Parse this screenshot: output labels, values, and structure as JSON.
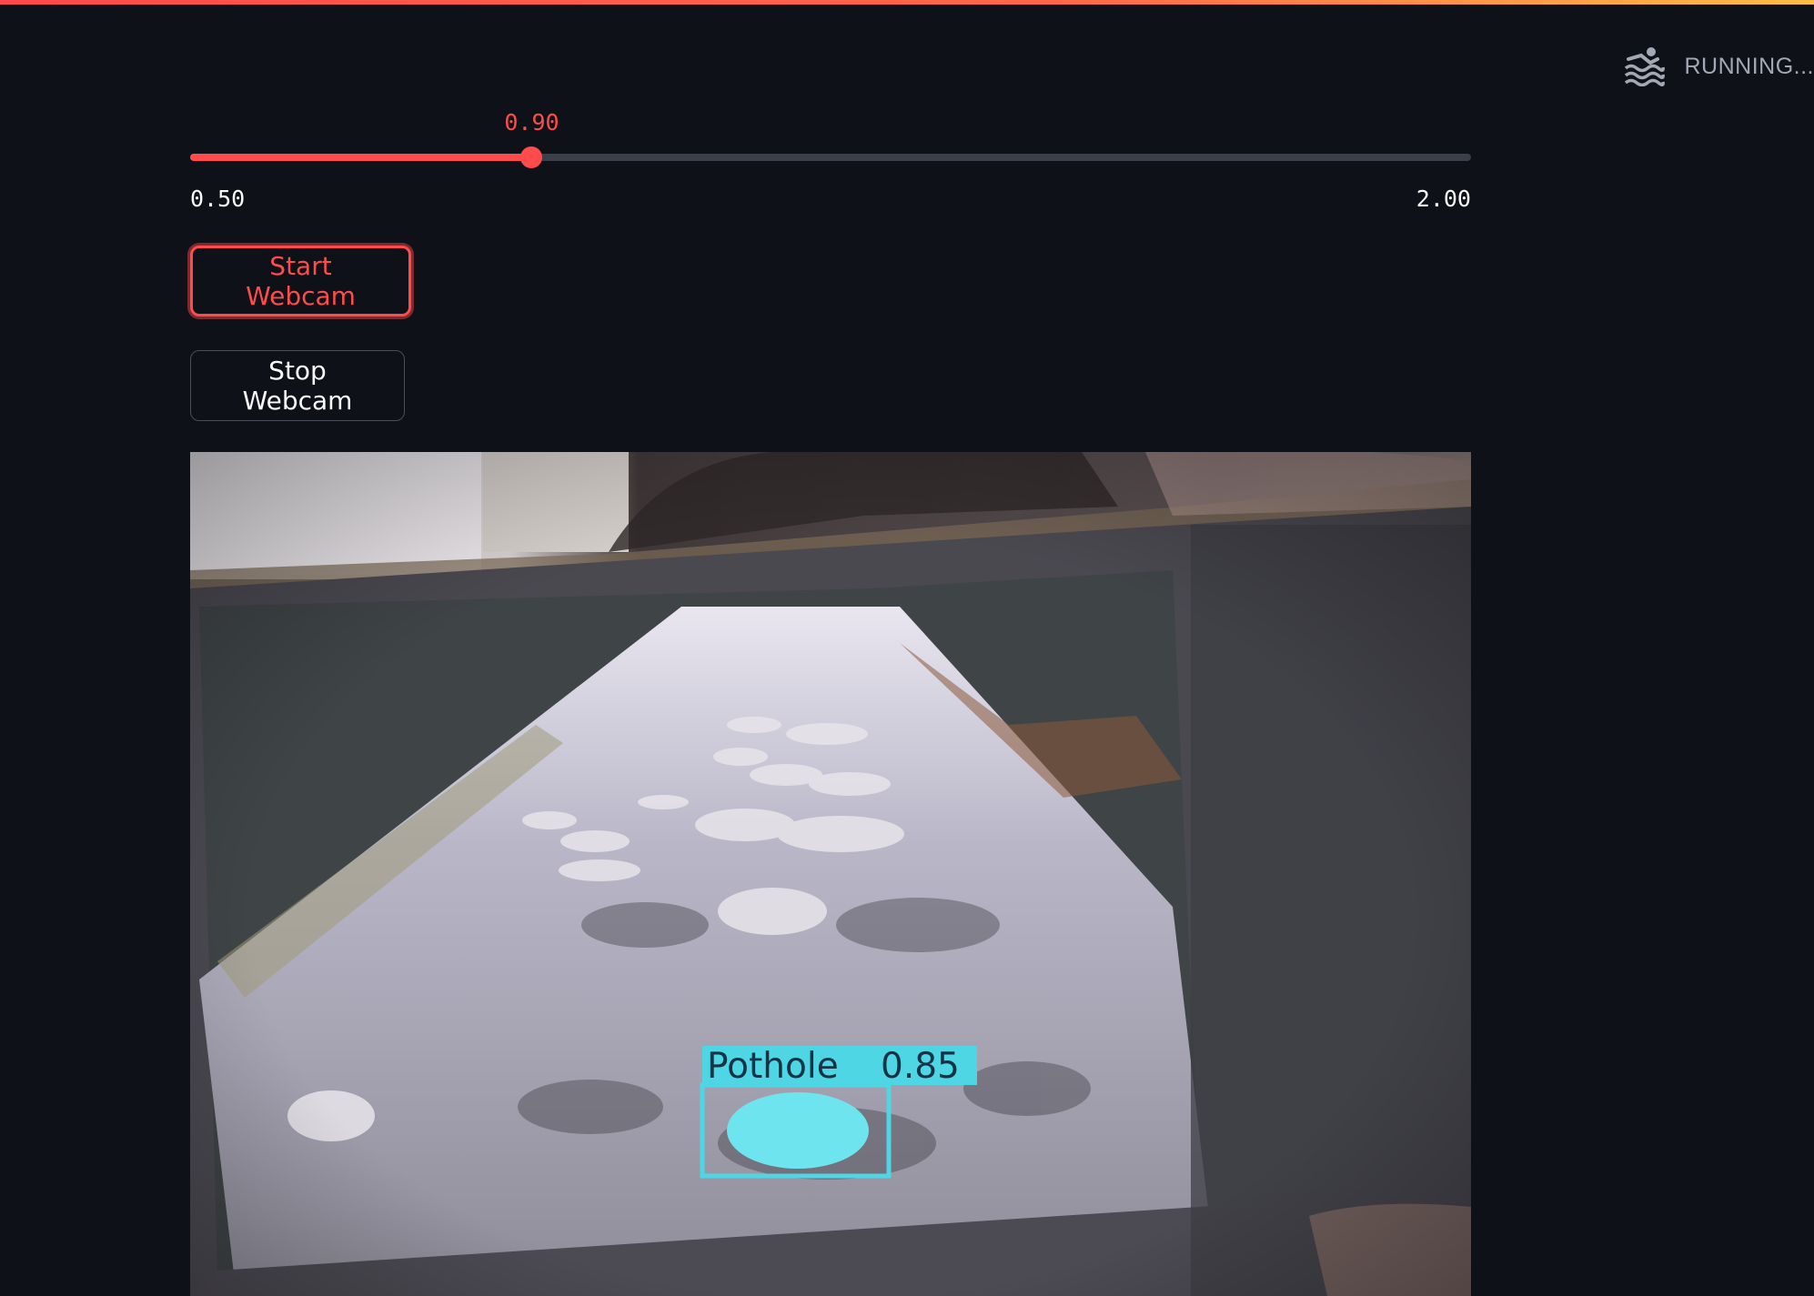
{
  "app": {
    "status_text": "RUNNING...",
    "status_icon": "swimmer-icon",
    "accent_color": "#ff4b4b"
  },
  "slider": {
    "value_label": "0.90",
    "min_label": "0.50",
    "max_label": "2.00",
    "value": 0.9,
    "min": 0.5,
    "max": 2.0
  },
  "buttons": {
    "start_label": "Start Webcam",
    "stop_label": "Stop Webcam"
  },
  "webcam": {
    "detections": [
      {
        "label": "Pothole",
        "confidence": "0.85",
        "color": "#4fd6e4"
      }
    ]
  }
}
